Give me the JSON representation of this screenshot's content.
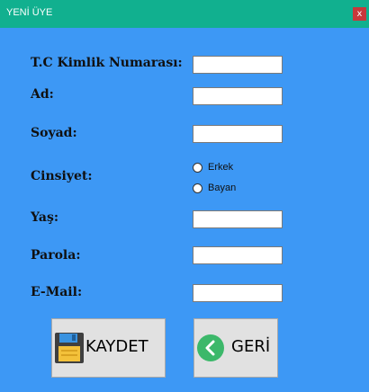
{
  "window": {
    "title": "YENİ ÜYE",
    "close_label": "x"
  },
  "form": {
    "tc_label": "T.C Kimlik Numarası:",
    "ad_label": "Ad:",
    "soyad_label": "Soyad:",
    "cinsiyet_label": "Cinsiyet:",
    "yas_label": "Yaş:",
    "parola_label": "Parola:",
    "email_label": "E-Mail:",
    "tc_value": "",
    "ad_value": "",
    "soyad_value": "",
    "yas_value": "",
    "parola_value": "",
    "email_value": "",
    "gender_options": [
      "Erkek",
      "Bayan"
    ]
  },
  "buttons": {
    "save_label": "KAYDET",
    "back_label": "GERİ"
  },
  "colors": {
    "background": "#3d98f5",
    "titlebar": "#11b08f",
    "close": "#c8383b",
    "back_icon": "#3cb86a"
  },
  "icons": {
    "save": "floppy-disk-icon",
    "back": "chevron-left-circle-icon"
  }
}
